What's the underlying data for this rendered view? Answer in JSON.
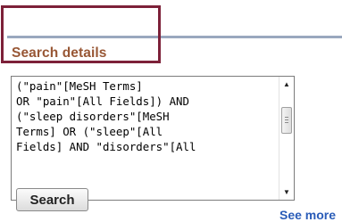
{
  "section": {
    "heading": "Search details",
    "highlight_color": "#7d2139",
    "heading_color": "#985735"
  },
  "query": {
    "text": "(\"pain\"[MeSH Terms]\nOR \"pain\"[All Fields]) AND\n(\"sleep disorders\"[MeSH\nTerms] OR (\"sleep\"[All\nFields] AND \"disorders\"[All"
  },
  "scrollbar": {
    "up_icon": "triangle-up",
    "down_icon": "triangle-down"
  },
  "actions": {
    "search_label": "Search",
    "see_more_label": "See more"
  }
}
